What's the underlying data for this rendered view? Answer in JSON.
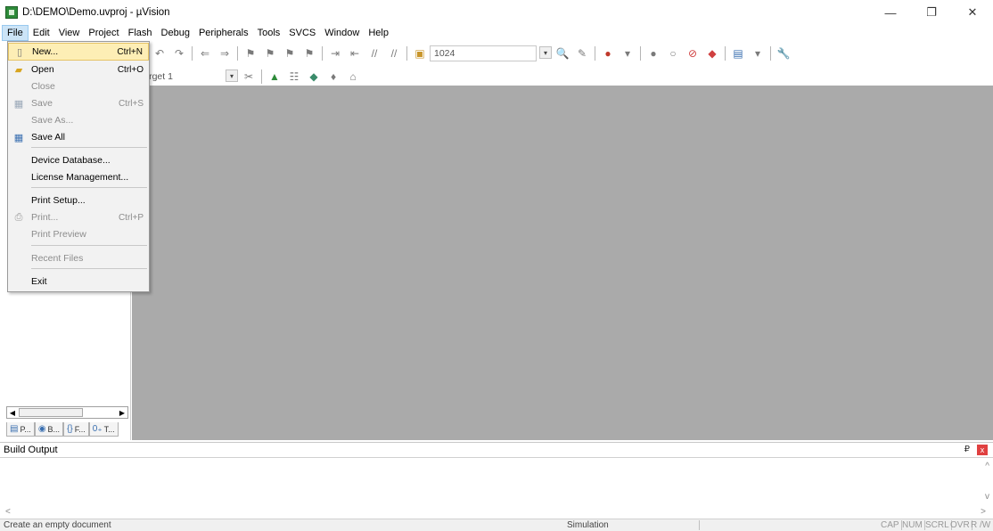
{
  "window": {
    "title": "D:\\DEMO\\Demo.uvproj - µVision",
    "minimize": "—",
    "restore": "❐",
    "close": "✕"
  },
  "menubar": {
    "items": [
      "File",
      "Edit",
      "View",
      "Project",
      "Flash",
      "Debug",
      "Peripherals",
      "Tools",
      "SVCS",
      "Window",
      "Help"
    ]
  },
  "toolbar": {
    "search_value": "1024",
    "target_value": "Target 1"
  },
  "file_menu": {
    "items": [
      {
        "label": "New...",
        "shortcut": "Ctrl+N",
        "icon": "new-file-icon",
        "enabled": true,
        "highlighted": true
      },
      {
        "label": "Open",
        "shortcut": "Ctrl+O",
        "icon": "open-folder-icon",
        "enabled": true
      },
      {
        "label": "Close",
        "shortcut": "",
        "icon": "",
        "enabled": false
      },
      {
        "label": "Save",
        "shortcut": "Ctrl+S",
        "icon": "save-icon",
        "enabled": false
      },
      {
        "label": "Save As...",
        "shortcut": "",
        "icon": "",
        "enabled": false
      },
      {
        "label": "Save All",
        "shortcut": "",
        "icon": "save-all-icon",
        "enabled": true
      },
      {
        "label": "Device Database...",
        "shortcut": "",
        "icon": "",
        "enabled": true
      },
      {
        "label": "License Management...",
        "shortcut": "",
        "icon": "",
        "enabled": true
      },
      {
        "label": "Print Setup...",
        "shortcut": "",
        "icon": "",
        "enabled": true
      },
      {
        "label": "Print...",
        "shortcut": "Ctrl+P",
        "icon": "print-icon",
        "enabled": false
      },
      {
        "label": "Print Preview",
        "shortcut": "",
        "icon": "",
        "enabled": false
      },
      {
        "label": "Recent Files",
        "shortcut": "",
        "icon": "",
        "enabled": false
      },
      {
        "label": "Exit",
        "shortcut": "",
        "icon": "",
        "enabled": true
      }
    ]
  },
  "project_panel": {
    "tabs": [
      {
        "label": "P...",
        "icon": "project-icon"
      },
      {
        "label": "B...",
        "icon": "books-icon"
      },
      {
        "label": "F...",
        "icon": "functions-icon"
      },
      {
        "label": "T...",
        "icon": "templates-icon"
      }
    ]
  },
  "build_output": {
    "title": "Build Output",
    "pin": "₽",
    "close": "x"
  },
  "statusbar": {
    "message": "Create an empty document",
    "mode": "Simulation",
    "indicators": [
      "CAP",
      "NUM",
      "SCRL",
      "OVR",
      "R /W"
    ]
  },
  "colors": {
    "menu_highlight": "#fdeeb5",
    "editor_background": "#aaaaaa",
    "active_menu": "#cce4f7"
  }
}
